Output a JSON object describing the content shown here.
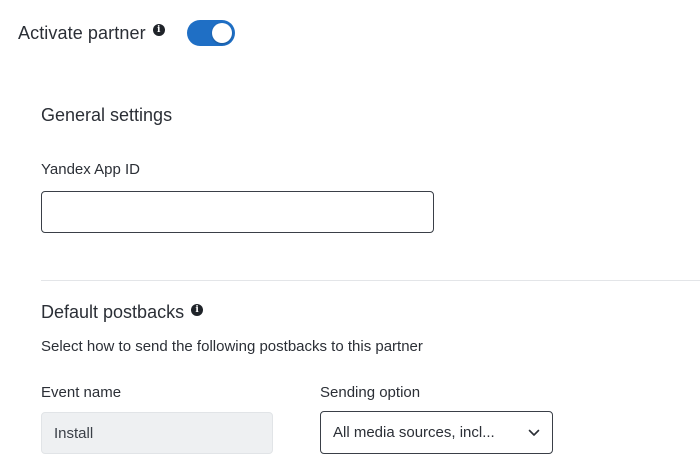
{
  "activate": {
    "label": "Activate partner",
    "info_icon": "info-icon",
    "toggle_state": "on"
  },
  "general_settings": {
    "title": "General settings",
    "app_id_label": "Yandex App ID",
    "app_id_value": "",
    "app_id_placeholder": ""
  },
  "default_postbacks": {
    "title": "Default postbacks",
    "info_icon": "info-icon",
    "description": "Select how to send the following postbacks to this partner",
    "event_name_header": "Event name",
    "sending_option_header": "Sending option",
    "rows": [
      {
        "event_name": "Install",
        "sending_option": "All media sources, incl..."
      }
    ]
  },
  "colors": {
    "toggle_on": "#1f6fc5",
    "text": "#2b2f36",
    "readonly_bg": "#eef0f2",
    "divider": "#e3e5e8"
  }
}
